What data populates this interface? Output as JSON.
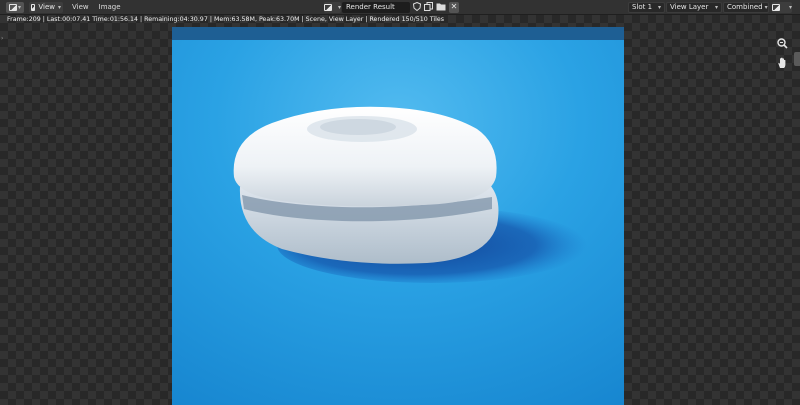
{
  "header": {
    "editor_type_icon": "image-editor-icon",
    "view_dropdown_label": "View",
    "menu": [
      "View",
      "Image"
    ],
    "image_name": "Render Result",
    "slot": "Slot 1",
    "view_layer": "View Layer",
    "pass": "Combined",
    "icons": {
      "editor": "image-editor-icon",
      "image_browse": "image-browse-icon",
      "fake_user": "shield-icon",
      "duplicate": "copy-icon",
      "open": "folder-icon",
      "unlink": "close-icon",
      "display_channels": "channels-icon"
    }
  },
  "render": {
    "stats": "Frame:209 | Last:00:07.41 Time:01:56.14 | Remaining:04:30.97 | Mem:63.58M, Peak:63.70M | Scene, View Layer | Rendered 150/510 Tiles",
    "colors": {
      "background": "#2aa0e2",
      "object": "#f2f2f2",
      "shadow": "#1553a8"
    }
  },
  "sidebar_tools": [
    "zoom-icon",
    "hand-pan-icon"
  ]
}
